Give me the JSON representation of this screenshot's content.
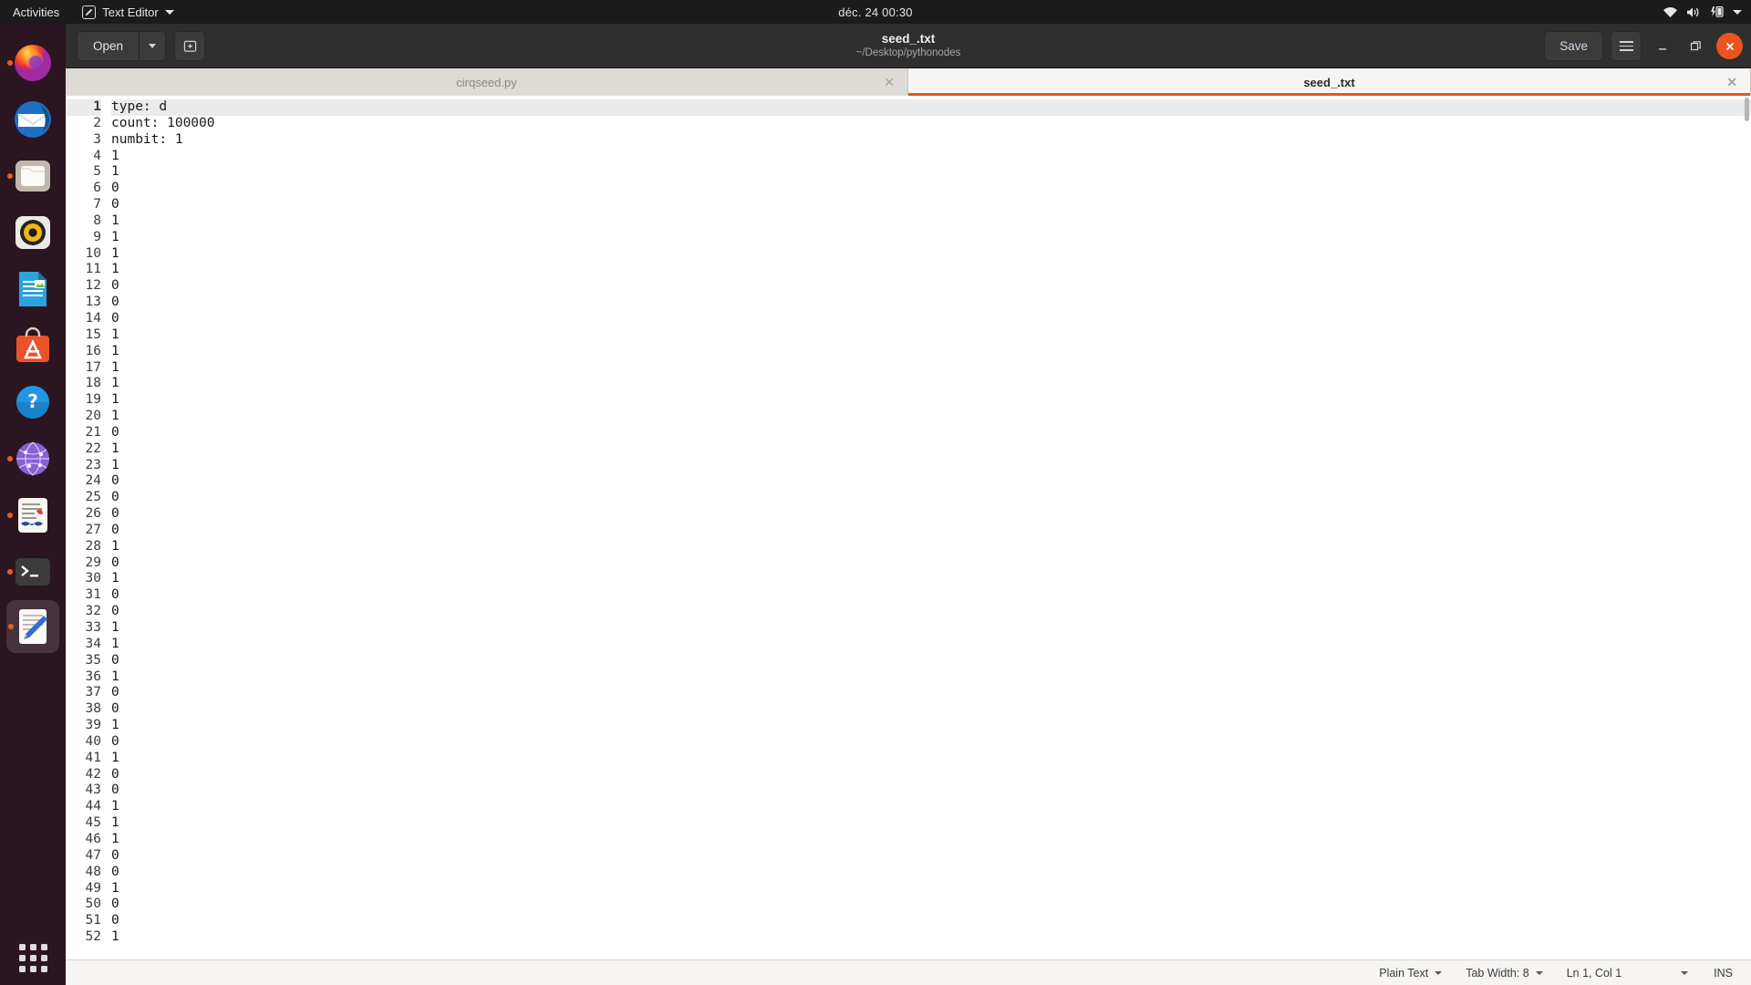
{
  "topbar": {
    "activities": "Activities",
    "app_menu": "Text Editor",
    "clock": "déc. 24  00:30",
    "indicators": [
      "wifi-icon",
      "volume-icon",
      "battery-charging-icon",
      "system-menu-caret"
    ]
  },
  "dock": {
    "items": [
      {
        "name": "firefox",
        "label": "Firefox",
        "running": true
      },
      {
        "name": "thunderbird",
        "label": "Thunderbird",
        "running": false
      },
      {
        "name": "files",
        "label": "Files",
        "running": true
      },
      {
        "name": "rhythmbox",
        "label": "Rhythmbox",
        "running": false
      },
      {
        "name": "libreoffice-writer",
        "label": "LibreOffice Writer",
        "running": false
      },
      {
        "name": "ubuntu-software",
        "label": "Ubuntu Software",
        "running": false
      },
      {
        "name": "help",
        "label": "Help",
        "running": false
      },
      {
        "name": "network-app",
        "label": "Network",
        "running": true
      },
      {
        "name": "document-viewer",
        "label": "Document Viewer",
        "running": true
      },
      {
        "name": "terminal",
        "label": "Terminal",
        "running": true
      },
      {
        "name": "text-editor",
        "label": "Text Editor",
        "running": true,
        "active": true
      }
    ],
    "show_apps": "Show Applications"
  },
  "header": {
    "open_label": "Open",
    "new_tab_label": "+",
    "title": "seed_.txt",
    "subtitle": "~/Desktop/pythonodes",
    "save_label": "Save",
    "menu_label": "Main Menu",
    "minimize_label": "−",
    "maximize_label": "❐",
    "close_label": "✕"
  },
  "tabs": [
    {
      "label": "cirqseed.py",
      "active": false,
      "close": "✕"
    },
    {
      "label": "seed_.txt",
      "active": true,
      "close": "✕"
    }
  ],
  "editor": {
    "cursor_line": 1,
    "lines": [
      "type: d",
      "count: 100000",
      "numbit: 1",
      "1",
      "1",
      "0",
      "0",
      "1",
      "1",
      "1",
      "1",
      "0",
      "0",
      "0",
      "1",
      "1",
      "1",
      "1",
      "1",
      "1",
      "0",
      "1",
      "1",
      "0",
      "0",
      "0",
      "0",
      "1",
      "0",
      "1",
      "0",
      "0",
      "1",
      "1",
      "0",
      "1",
      "0",
      "0",
      "1",
      "0",
      "1",
      "0",
      "0",
      "1",
      "1",
      "1",
      "0",
      "0",
      "1",
      "0",
      "0",
      "1"
    ]
  },
  "statusbar": {
    "language": "Plain Text",
    "tab_width": "Tab Width: 8",
    "position": "Ln 1, Col 1",
    "insert_mode": "INS"
  }
}
